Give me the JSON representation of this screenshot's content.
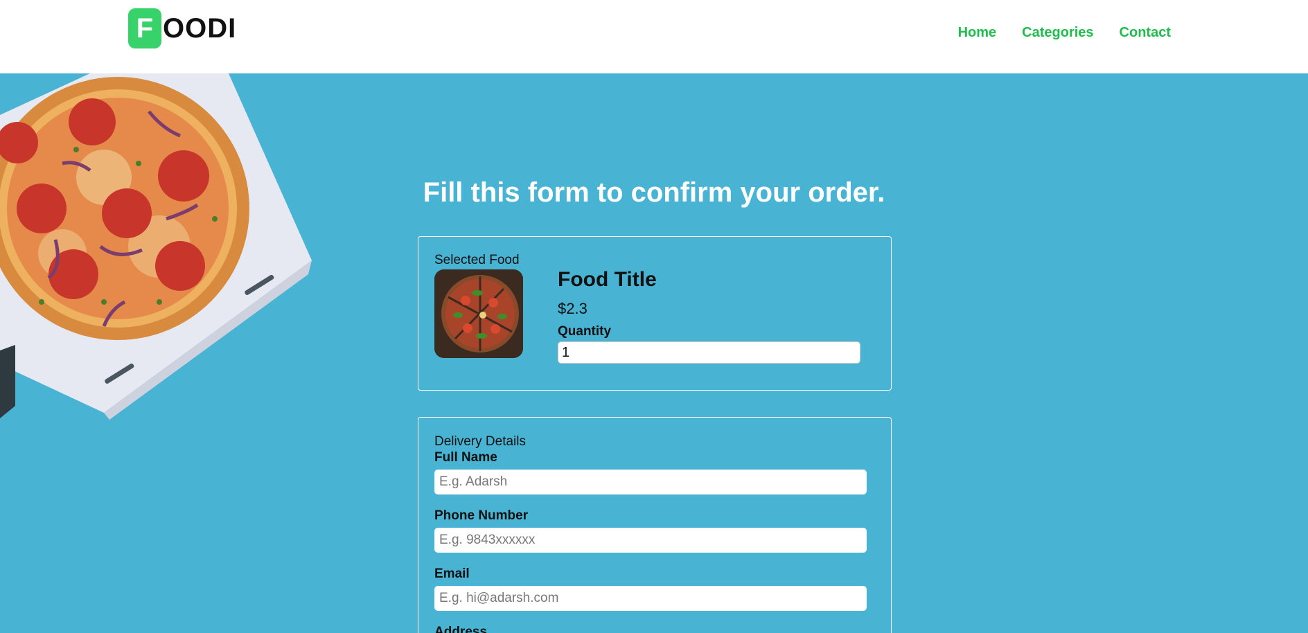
{
  "brand": {
    "badge_letter": "F",
    "wordmark": "OODI"
  },
  "nav": {
    "items": [
      "Home",
      "Categories",
      "Contact"
    ]
  },
  "page": {
    "title": "Fill this form to confirm your order."
  },
  "selected_food": {
    "legend": "Selected Food",
    "title": "Food Title",
    "price": "$2.3",
    "quantity_label": "Quantity",
    "quantity_value": "1"
  },
  "delivery": {
    "legend": "Delivery Details",
    "full_name_label": "Full Name",
    "full_name_placeholder": "E.g. Adarsh",
    "phone_label": "Phone Number",
    "phone_placeholder": "E.g. 9843xxxxxx",
    "email_label": "Email",
    "email_placeholder": "E.g. hi@adarsh.com",
    "address_label": "Address"
  },
  "colors": {
    "accent": "#1fbd4c",
    "background": "#49b3d3",
    "logo_badge": "#37d36a"
  }
}
